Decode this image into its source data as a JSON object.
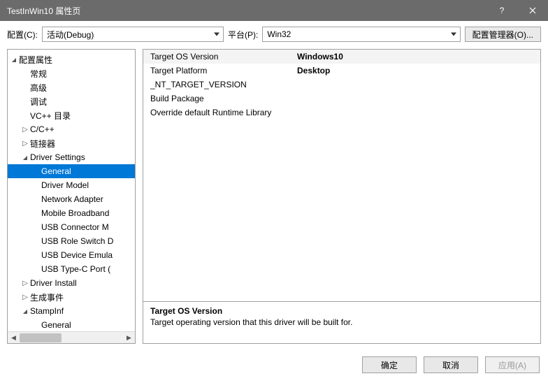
{
  "titlebar": {
    "title": "TestInWin10 属性页"
  },
  "toolbar": {
    "config_label": "配置(C):",
    "config_value": "活动(Debug)",
    "platform_label": "平台(P):",
    "platform_value": "Win32",
    "config_mgr_label": "配置管理器(O)..."
  },
  "tree": [
    {
      "label": "配置属性",
      "indent": 0,
      "arrow": "down"
    },
    {
      "label": "常规",
      "indent": 1,
      "arrow": "none"
    },
    {
      "label": "高级",
      "indent": 1,
      "arrow": "none"
    },
    {
      "label": "调试",
      "indent": 1,
      "arrow": "none"
    },
    {
      "label": "VC++ 目录",
      "indent": 1,
      "arrow": "none"
    },
    {
      "label": "C/C++",
      "indent": 1,
      "arrow": "right"
    },
    {
      "label": "链接器",
      "indent": 1,
      "arrow": "right"
    },
    {
      "label": "Driver Settings",
      "indent": 1,
      "arrow": "down"
    },
    {
      "label": "General",
      "indent": 2,
      "arrow": "none",
      "selected": true
    },
    {
      "label": "Driver Model",
      "indent": 2,
      "arrow": "none"
    },
    {
      "label": "Network Adapter",
      "indent": 2,
      "arrow": "none"
    },
    {
      "label": "Mobile Broadband",
      "indent": 2,
      "arrow": "none"
    },
    {
      "label": "USB Connector M",
      "indent": 2,
      "arrow": "none"
    },
    {
      "label": "USB Role Switch D",
      "indent": 2,
      "arrow": "none"
    },
    {
      "label": "USB Device Emula",
      "indent": 2,
      "arrow": "none"
    },
    {
      "label": "USB Type-C Port (",
      "indent": 2,
      "arrow": "none"
    },
    {
      "label": "Driver Install",
      "indent": 1,
      "arrow": "right"
    },
    {
      "label": "生成事件",
      "indent": 1,
      "arrow": "right"
    },
    {
      "label": "StampInf",
      "indent": 1,
      "arrow": "down"
    },
    {
      "label": "General",
      "indent": 2,
      "arrow": "none"
    }
  ],
  "properties": [
    {
      "key": "Target OS Version",
      "val": "Windows10"
    },
    {
      "key": "Target Platform",
      "val": "Desktop"
    },
    {
      "key": "_NT_TARGET_VERSION",
      "val": ""
    },
    {
      "key": "Build Package",
      "val": ""
    },
    {
      "key": "Override default Runtime Library",
      "val": ""
    }
  ],
  "description": {
    "title": "Target OS Version",
    "body": "Target operating version that this driver will be built for."
  },
  "footer": {
    "ok": "确定",
    "cancel": "取消",
    "apply": "应用(A)"
  }
}
